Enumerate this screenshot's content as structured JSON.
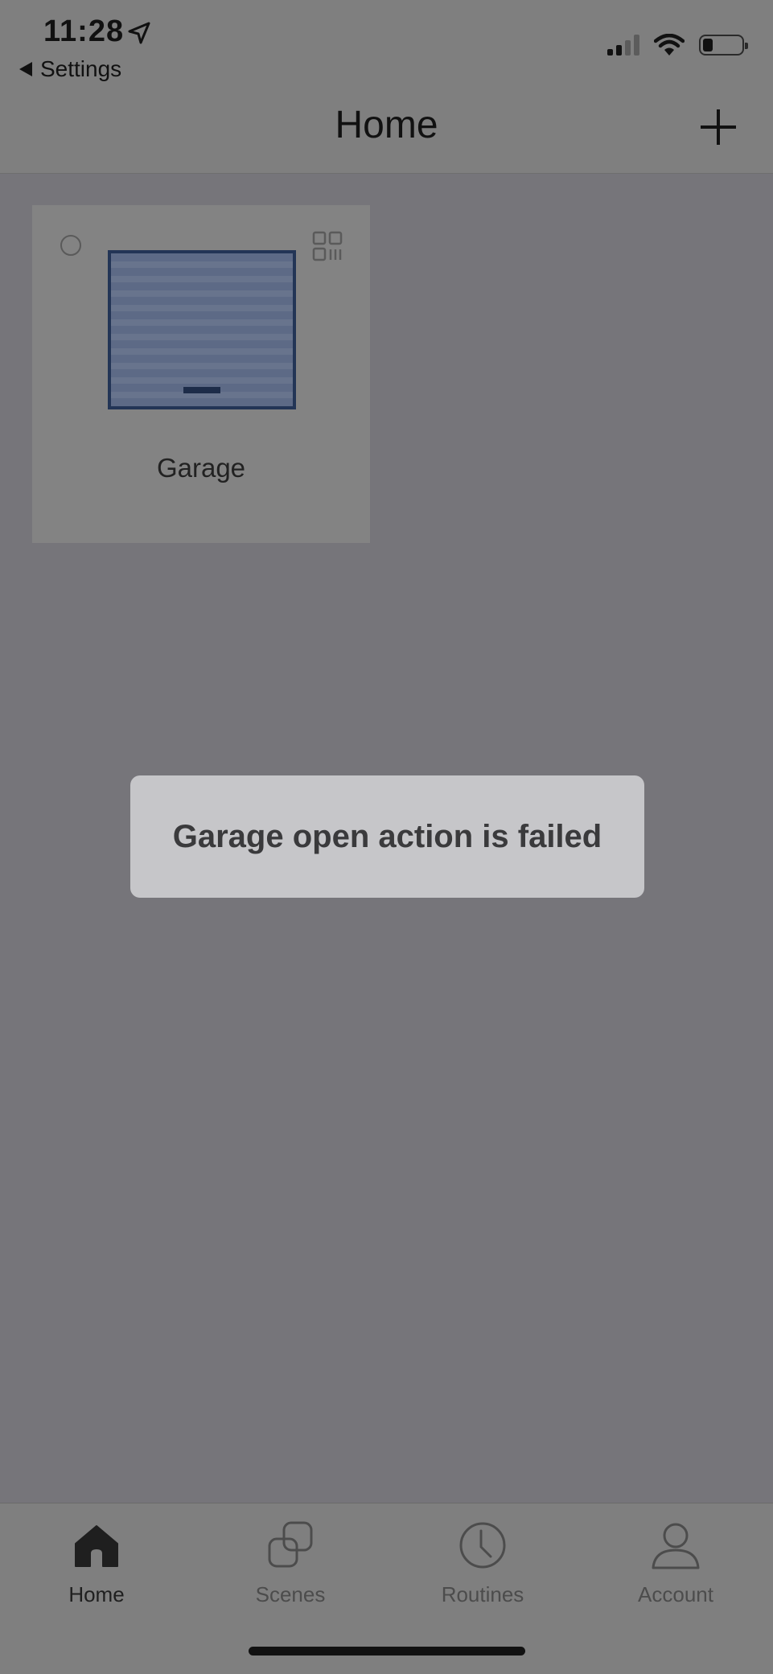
{
  "status_bar": {
    "time": "11:28",
    "back_label": "Settings",
    "location_icon": "location-arrow-icon",
    "signal_icon": "cellular-signal-icon",
    "wifi_icon": "wifi-icon",
    "battery_icon": "battery-icon"
  },
  "header": {
    "title": "Home",
    "add_icon": "plus-icon"
  },
  "devices": [
    {
      "label": "Garage",
      "image_icon": "garage-door-icon",
      "qr_icon": "qr-code-icon"
    }
  ],
  "toast": {
    "message": "Garage open action is failed"
  },
  "tabbar": {
    "tabs": [
      {
        "label": "Home",
        "icon": "home-icon",
        "active": true
      },
      {
        "label": "Scenes",
        "icon": "scenes-icon",
        "active": false
      },
      {
        "label": "Routines",
        "icon": "clock-icon",
        "active": false
      },
      {
        "label": "Account",
        "icon": "person-icon",
        "active": false
      }
    ]
  },
  "colors": {
    "overlay_background": "#76757a",
    "toast_background": "#c6c6c9",
    "garage_door": "#5d6a86"
  }
}
